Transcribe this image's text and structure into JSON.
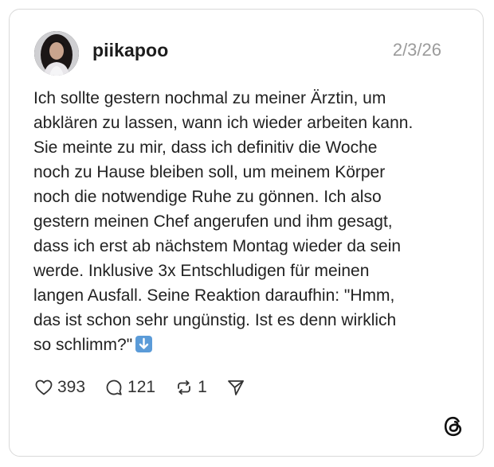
{
  "post": {
    "username": "piikapoo",
    "date": "2/3/26",
    "lines": [
      "Ich sollte gestern nochmal zu meiner Ärztin, um",
      "abklären zu lassen, wann ich wieder arbeiten kann.",
      "Sie meinte zu mir, dass ich definitiv die Woche",
      "noch zu Hause bleiben soll, um meinem Körper",
      "noch die notwendige Ruhe zu gönnen. Ich also",
      "gestern meinen Chef angerufen und ihm gesagt,",
      "dass ich erst ab nächstem Montag wieder da sein",
      "werde. Inklusive 3x Entschludigen für meinen",
      "langen Ausfall. Seine Reaktion daraufhin: \"Hmm,",
      "das ist schon sehr ungünstig. Ist es denn wirklich",
      "so schlimm?\""
    ],
    "trailing_emoji": "down-arrow-emoji"
  },
  "actions": {
    "likes": "393",
    "replies": "121",
    "reposts": "1"
  },
  "icons": {
    "like": "heart-icon",
    "reply": "speech-bubble-icon",
    "repost": "repost-icon",
    "share": "send-icon",
    "brand": "threads-logo-icon"
  },
  "colors": {
    "border": "#d9d9d9",
    "date": "#9b9b9b",
    "text": "#222222",
    "emoji": "#5b9bd8"
  }
}
